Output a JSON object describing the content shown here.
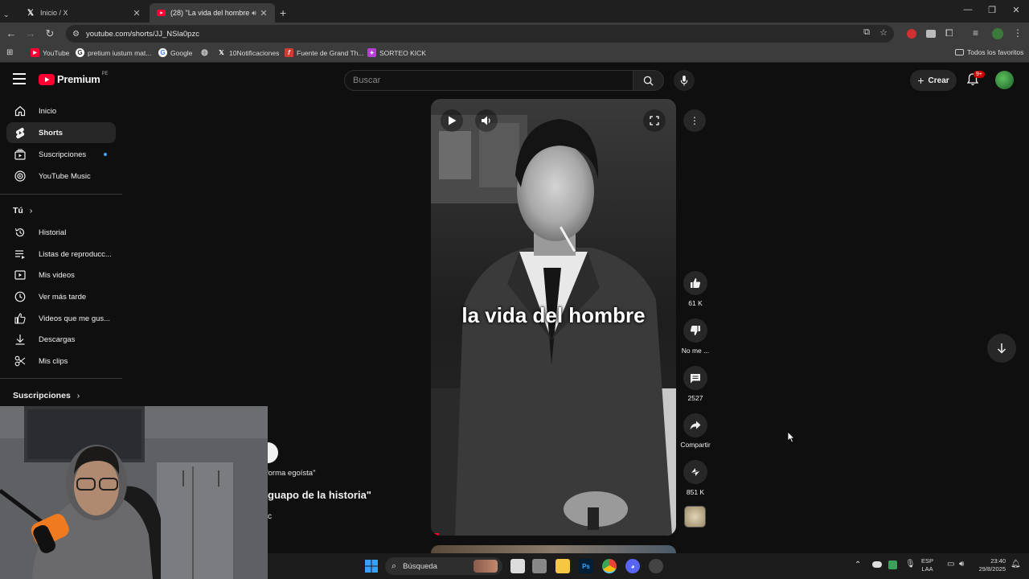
{
  "browser": {
    "tabs": [
      {
        "title": "Inicio / X",
        "favicon": "x-icon"
      },
      {
        "title": "(28) \"La vida del hombre m",
        "favicon": "youtube-icon"
      }
    ],
    "url": "youtube.com/shorts/JJ_NSla0pzc",
    "bookmarks": [
      "YouTube",
      "pretium iustum mat...",
      "Google",
      "10Notificaciones",
      "Fuente de Grand Th...",
      "SORTEO KICK"
    ],
    "bookmarks_right": "Todos los favoritos"
  },
  "youtube": {
    "logo": "Premium",
    "region": "PE",
    "search_placeholder": "Buscar",
    "create_label": "Crear",
    "notifications_badge": "9+"
  },
  "sidebar": {
    "items": [
      {
        "label": "Inicio",
        "icon": "home-icon"
      },
      {
        "label": "Shorts",
        "icon": "shorts-icon"
      },
      {
        "label": "Suscripciones",
        "icon": "subscriptions-icon"
      },
      {
        "label": "YouTube Music",
        "icon": "music-icon"
      }
    ],
    "you_heading": "Tú",
    "you_items": [
      {
        "label": "Historial",
        "icon": "history-icon"
      },
      {
        "label": "Listas de reproducc...",
        "icon": "playlist-icon"
      },
      {
        "label": "Mis videos",
        "icon": "my-videos-icon"
      },
      {
        "label": "Ver más tarde",
        "icon": "watch-later-icon"
      },
      {
        "label": "Videos que me gus...",
        "icon": "liked-icon"
      },
      {
        "label": "Descargas",
        "icon": "download-icon"
      },
      {
        "label": "Mis clips",
        "icon": "clips-icon"
      }
    ],
    "subscriptions_heading": "Suscripciones"
  },
  "short": {
    "caption": "la vida del hombre",
    "overlay_line1": "forma egoísta\"",
    "overlay_title": "guapo de la historia\"",
    "overlay_line3": "c"
  },
  "actions": {
    "likes": "61 K",
    "dislike": "No me ...",
    "comments": "2527",
    "share": "Compartir",
    "remix": "851 K"
  },
  "taskbar": {
    "search_label": "Búsqueda",
    "lang1": "ESP",
    "lang2": "LAA",
    "time": "23:40",
    "date": "29/8/2025"
  },
  "colors": {
    "youtube_red": "#ff0033",
    "background": "#0f0f0f",
    "chip": "#272727"
  }
}
